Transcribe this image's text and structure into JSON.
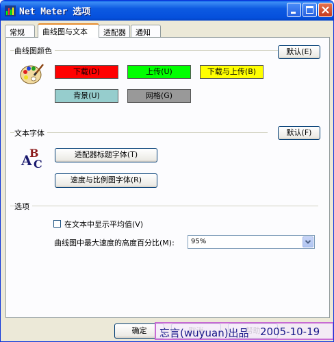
{
  "window": {
    "title": "Net Meter 选项"
  },
  "tabs": [
    {
      "label": "常规"
    },
    {
      "label": "曲线图与文本"
    },
    {
      "label": "适配器"
    },
    {
      "label": "通知"
    }
  ],
  "graph_colors": {
    "header": "曲线图颜色",
    "default_button": "默认(E)",
    "download": {
      "label": "下载(D)",
      "color": "#ff0000"
    },
    "upload": {
      "label": "上传(U)",
      "color": "#00ff00"
    },
    "both": {
      "label": "下载与上传(B)",
      "color": "#ffff00"
    },
    "background": {
      "label": "背景(U)",
      "color": "#96cdcd"
    },
    "grid": {
      "label": "网格(G)",
      "color": "#999999"
    }
  },
  "text_font": {
    "header": "文本字体",
    "default_button": "默认(F)",
    "adapter_title_font_button": "适配器标题字体(T)",
    "speed_scale_font_button": "速度与比例图字体(R)"
  },
  "options": {
    "header": "选项",
    "show_average_label": "在文本中显示平均值(V)",
    "max_speed_label": "曲线图中最大速度的高度百分比(M):",
    "max_speed_value": "95%"
  },
  "footer": {
    "ok_button": "确定",
    "cancel_button": "取消",
    "help_button": "帮助"
  },
  "watermark": {
    "author": "忘言(wuyuan)出品",
    "date": "2005-10-19"
  }
}
